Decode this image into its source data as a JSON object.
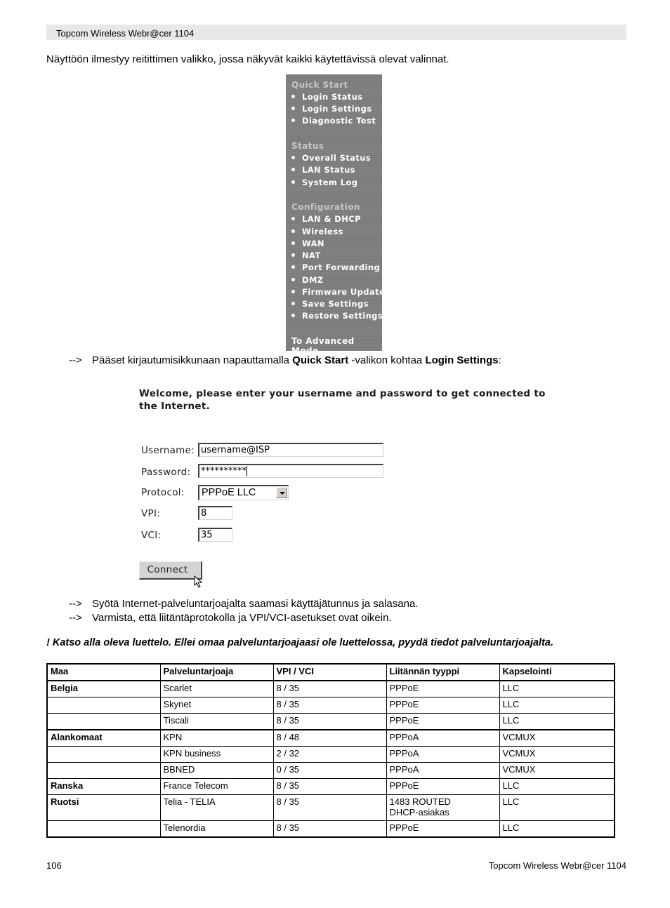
{
  "header": {
    "title": "Topcom Wireless Webr@cer 1104"
  },
  "intro": "Näyttöön ilmestyy reitittimen valikko, jossa näkyvät kaikki käytettävissä olevat valinnat.",
  "menu": {
    "sections": [
      {
        "title": "Quick Start",
        "items": [
          "Login Status",
          "Login Settings",
          "Diagnostic Test"
        ]
      },
      {
        "title": "Status",
        "items": [
          "Overall Status",
          "LAN Status",
          "System Log"
        ]
      },
      {
        "title": "Configuration",
        "items": [
          "LAN & DHCP",
          "Wireless",
          "WAN",
          "NAT",
          "Port Forwarding",
          "DMZ",
          "Firmware Update",
          "Save Settings",
          "Restore Settings"
        ]
      }
    ],
    "advanced": "To Advanced Mode"
  },
  "step1": {
    "arrow": "-->",
    "pre": "Pääset kirjautumisikkunaan napauttamalla ",
    "bold1": "Quick Start",
    "mid": " -valikon kohtaa ",
    "bold2": "Login Settings",
    "post": ":"
  },
  "login_form": {
    "welcome": "Welcome, please enter your username and password to get connected to the Internet.",
    "username_label": "Username:",
    "username_value": "username@ISP",
    "password_label": "Password:",
    "password_value": "**********",
    "protocol_label": "Protocol:",
    "protocol_value": "PPPoE LLC",
    "vpi_label": "VPI:",
    "vpi_value": "8",
    "vci_label": "VCI:",
    "vci_value": "35",
    "connect_label": "Connect"
  },
  "steps": [
    {
      "arrow": "-->",
      "text": "Syötä Internet-palveluntarjoajalta saamasi käyttäjätunnus ja salasana."
    },
    {
      "arrow": "-->",
      "text": "Varmista, että liitäntäprotokolla ja VPI/VCI-asetukset ovat oikein."
    }
  ],
  "note": "! Katso alla oleva luettelo. Ellei omaa palveluntarjoajaasi ole luettelossa, pyydä tiedot palveluntarjoajalta.",
  "table": {
    "headers": [
      "Maa",
      "Palveluntarjoaja",
      "VPI / VCI",
      "Liitännän tyyppi",
      "Kapselointi"
    ],
    "rows": [
      {
        "country": "Belgia",
        "provider": "Scarlet",
        "vpivci": "8 / 35",
        "type": "PPPoE",
        "encap": "LLC"
      },
      {
        "country": "",
        "provider": "Skynet",
        "vpivci": "8 / 35",
        "type": "PPPoE",
        "encap": "LLC"
      },
      {
        "country": "",
        "provider": "Tiscali",
        "vpivci": "8 / 35",
        "type": "PPPoE",
        "encap": "LLC"
      },
      {
        "country": "Alankomaat",
        "provider": "KPN",
        "vpivci": "8 / 48",
        "type": "PPPoA",
        "encap": "VCMUX"
      },
      {
        "country": "",
        "provider": "KPN business",
        "vpivci": "2 / 32",
        "type": "PPPoA",
        "encap": "VCMUX"
      },
      {
        "country": "",
        "provider": "BBNED",
        "vpivci": "0 / 35",
        "type": "PPPoA",
        "encap": "VCMUX"
      },
      {
        "country": "Ranska",
        "provider": "France Telecom",
        "vpivci": "8 / 35",
        "type": "PPPoE",
        "encap": "LLC"
      },
      {
        "country": "Ruotsi",
        "provider": "Telia - TELIA",
        "vpivci": "8 / 35",
        "type": "1483 ROUTED",
        "type2": "DHCP-asiakas",
        "encap": "LLC"
      },
      {
        "country": "",
        "provider": "Telenordia",
        "vpivci": "8 / 35",
        "type": "PPPoE",
        "encap": "LLC"
      }
    ]
  },
  "footer": {
    "page_number": "106",
    "title": "Topcom Wireless Webr@cer 1104"
  }
}
